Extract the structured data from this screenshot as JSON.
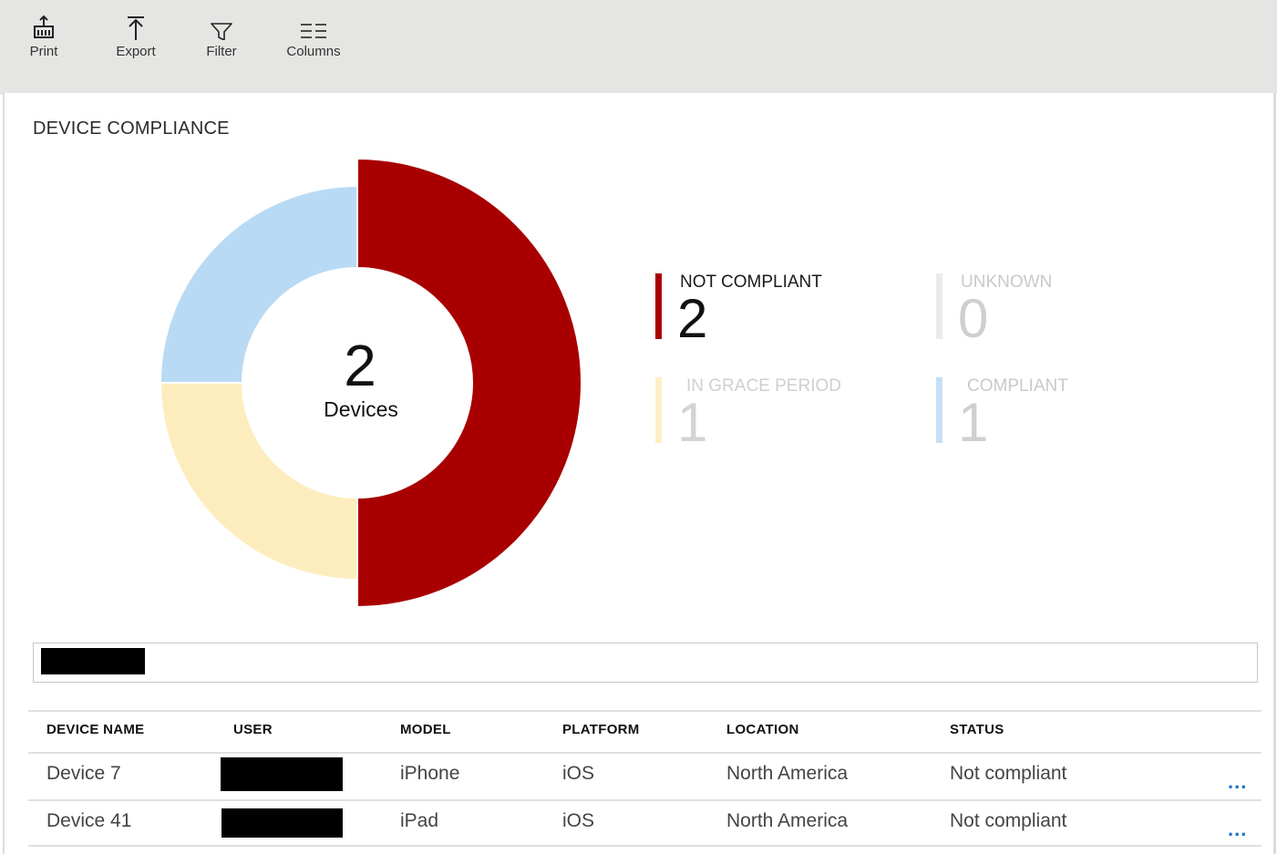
{
  "toolbar": {
    "print_label": "Print",
    "export_label": "Export",
    "filter_label": "Filter",
    "columns_label": "Columns"
  },
  "section_title": "DEVICE COMPLIANCE",
  "chart_data": {
    "type": "pie",
    "categories": [
      "NOT COMPLIANT",
      "IN GRACE PERIOD",
      "COMPLIANT",
      "UNKNOWN"
    ],
    "values": [
      2,
      1,
      1,
      0
    ],
    "colors": [
      "#a80000",
      "#fdedbe",
      "#b9daf4",
      "#efefef"
    ],
    "center_value": "2",
    "center_label": "Devices"
  },
  "legend": [
    {
      "name": "NOT COMPLIANT",
      "value": "2",
      "color": "#a80000",
      "text_color": "#1a1a1a",
      "value_color": "#111111"
    },
    {
      "name": "UNKNOWN",
      "value": "0",
      "color": "#ebebeb",
      "text_color": "#c9c9c9",
      "value_color": "#cfcfcf"
    },
    {
      "name": "IN GRACE PERIOD",
      "value": "1",
      "color": "#fdf0c8",
      "text_color": "#cfcfcf",
      "value_color": "#d3d3d3"
    },
    {
      "name": "COMPLIANT",
      "value": "1",
      "color": "#c6e0f6",
      "text_color": "#c9c9c9",
      "value_color": "#cfcfcf"
    }
  ],
  "table": {
    "headers": [
      "DEVICE NAME",
      "USER",
      "MODEL",
      "PLATFORM",
      "LOCATION",
      "STATUS"
    ],
    "rows": [
      {
        "device_name": "Device 7",
        "model": "iPhone",
        "platform": "iOS",
        "location": "North America",
        "status": "Not compliant",
        "more": "..."
      },
      {
        "device_name": "Device 41",
        "model": "iPad",
        "platform": "iOS",
        "location": "North America",
        "status": "Not compliant",
        "more": "..."
      }
    ]
  }
}
